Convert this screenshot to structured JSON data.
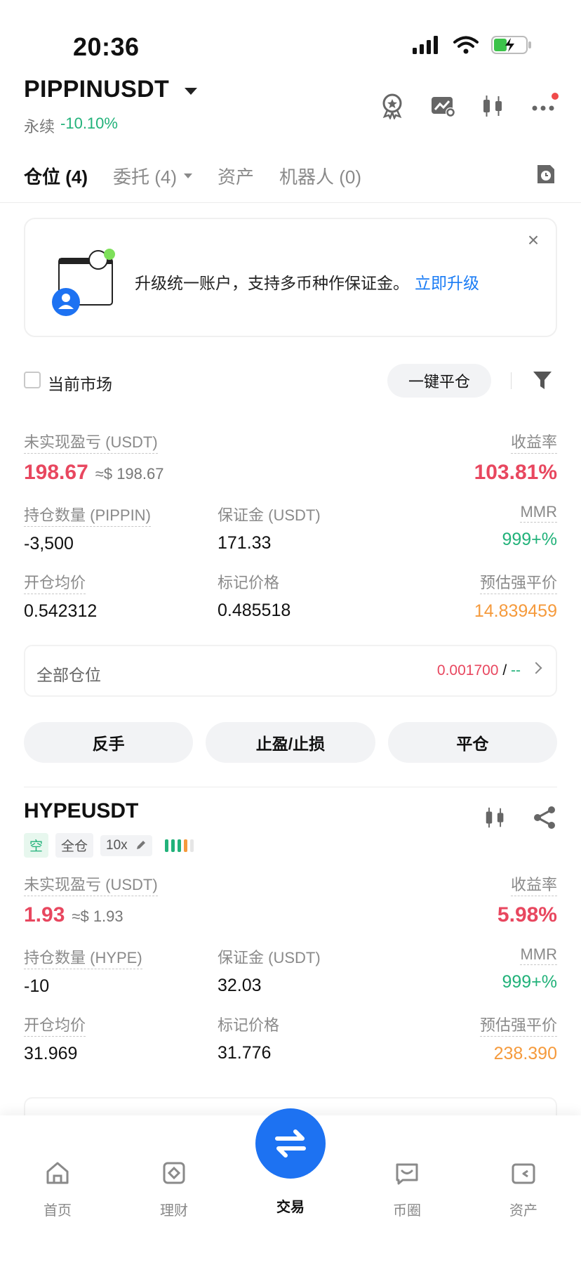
{
  "status": {
    "time": "20:36"
  },
  "header": {
    "symbol": "PIPPINUSDT",
    "type": "永续",
    "change": "-10.10%"
  },
  "tabs": [
    {
      "label": "仓位 (4)"
    },
    {
      "label": "委托 (4)"
    },
    {
      "label": "资产"
    },
    {
      "label": "机器人 (0)"
    }
  ],
  "banner": {
    "text": "升级统一账户，支持多币种作保证金。",
    "link": "立即升级"
  },
  "filter": {
    "current_market": "当前市场",
    "close_all": "一键平仓"
  },
  "position1": {
    "pnl_label": "未实现盈亏 (USDT)",
    "pnl": "198.67",
    "pnl_usd": "≈$ 198.67",
    "roe_label": "收益率",
    "roe": "103.81%",
    "qty_label": "持仓数量 (PIPPIN)",
    "qty": "-3,500",
    "margin_label": "保证金 (USDT)",
    "margin": "171.33",
    "mmr_label": "MMR",
    "mmr": "999+%",
    "entry_label": "开仓均价",
    "entry": "0.542312",
    "mark_label": "标记价格",
    "mark": "0.485518",
    "liq_label": "预估强平价",
    "liq": "14.839459"
  },
  "all_positions": {
    "label": "全部仓位",
    "value": "0.001700",
    "slash": " / ",
    "dash": "--"
  },
  "actions": {
    "reverse": "反手",
    "tpsl": "止盈/止损",
    "close": "平仓"
  },
  "position2": {
    "symbol": "HYPEUSDT",
    "side": "空",
    "mode": "全仓",
    "leverage": "10x",
    "pnl_label": "未实现盈亏 (USDT)",
    "pnl": "1.93",
    "pnl_usd": "≈$ 1.93",
    "roe_label": "收益率",
    "roe": "5.98%",
    "qty_label": "持仓数量 (HYPE)",
    "qty": "-10",
    "margin_label": "保证金 (USDT)",
    "margin": "32.03",
    "mmr_label": "MMR",
    "mmr": "999+%",
    "entry_label": "开仓均价",
    "entry": "31.969",
    "mark_label": "标记价格",
    "mark": "31.776",
    "liq_label": "预估强平价",
    "liq": "238.390"
  },
  "nav": [
    {
      "label": "首页",
      "icon": "home-icon"
    },
    {
      "label": "理财",
      "icon": "wealth-icon"
    },
    {
      "label": "交易",
      "icon": "trade-icon"
    },
    {
      "label": "币圈",
      "icon": "community-icon"
    },
    {
      "label": "资产",
      "icon": "wallet-icon"
    }
  ],
  "colors": {
    "up": "#22b27a",
    "down": "#e8475f",
    "liq": "#f59a3c",
    "accent": "#1d72f2"
  }
}
